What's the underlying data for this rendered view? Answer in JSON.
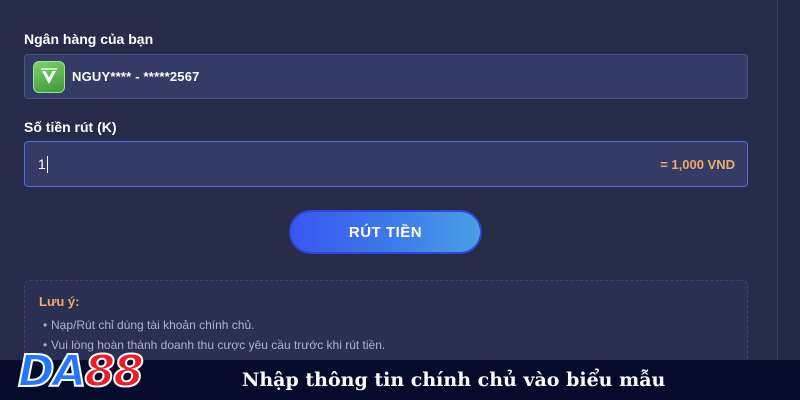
{
  "form": {
    "bank_label": "Ngân hàng của bạn",
    "bank_value": "NGUY**** - *****2567",
    "bank_logo_icon": "shield-v-logo-icon",
    "amount_label": "Số tiền rút (K)",
    "amount_value": "1",
    "amount_converted": "= 1,000 VND",
    "submit_label": "RÚT TIỀN"
  },
  "notice": {
    "title": "Lưu ý:",
    "items": [
      "Nạp/Rút chỉ dùng tài khoản chính chủ.",
      "Vui lòng hoàn thành doanh thu cược yêu cầu trước khi rút tiền."
    ]
  },
  "footer": {
    "logo_part1": "DA",
    "logo_part2": "88",
    "caption": "Nhập thông tin chính chủ vào biểu mẫu"
  },
  "colors": {
    "background": "#262b4a",
    "input_bg": "#343b66",
    "accent_orange": "#f2a96b",
    "button_blue": "#3a55f2",
    "logo_blue": "#1f78ff",
    "logo_red": "#ee1c25",
    "footer_bg": "#050b2b"
  }
}
